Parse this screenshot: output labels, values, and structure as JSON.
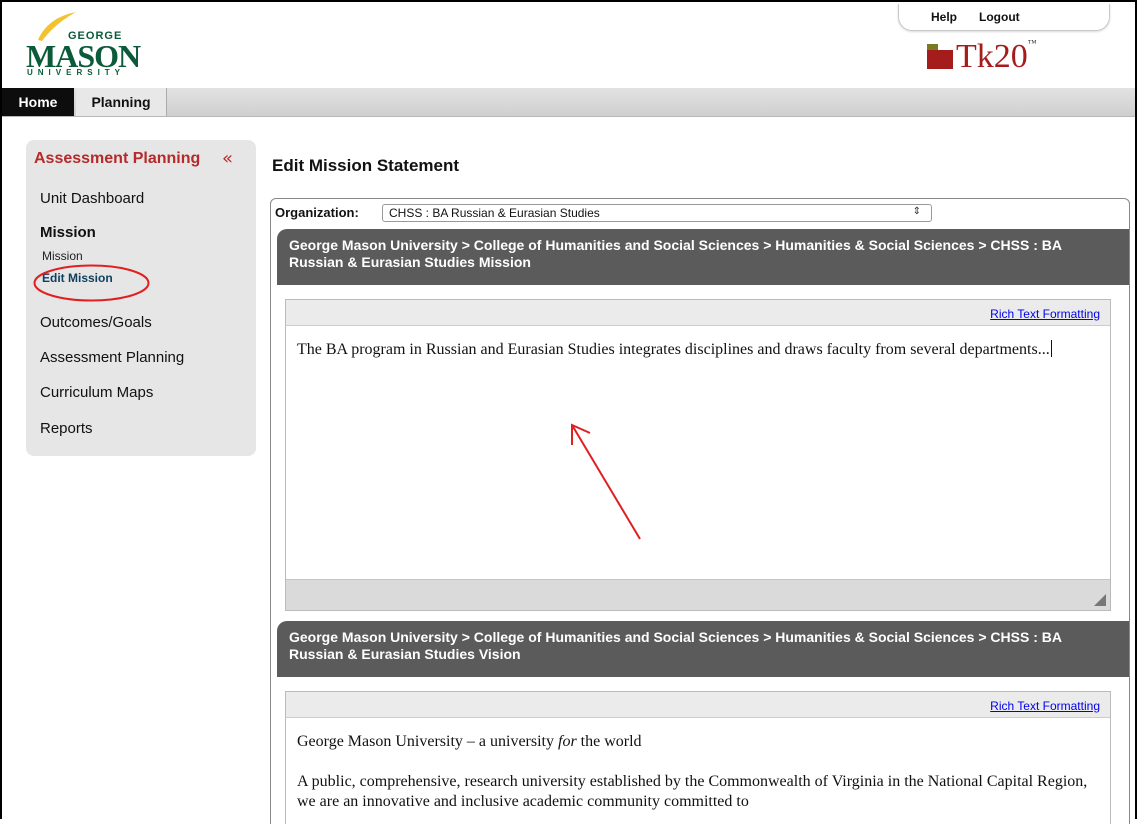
{
  "header": {
    "logo": {
      "top": "GEORGE",
      "main": "MASON",
      "bottom": "UNIVERSITY"
    },
    "help_label": "Help",
    "logout_label": "Logout",
    "product_logo": "Tk20",
    "product_tm": "™"
  },
  "nav": {
    "tabs": [
      {
        "label": "Home"
      },
      {
        "label": "Planning"
      }
    ]
  },
  "sidebar": {
    "title": "Assessment Planning",
    "collapse_glyph": "«",
    "items": [
      {
        "label": "Unit Dashboard"
      },
      {
        "label": "Mission"
      },
      {
        "label": "Mission"
      },
      {
        "label": "Edit Mission"
      },
      {
        "label": "Outcomes/Goals"
      },
      {
        "label": "Assessment Planning"
      },
      {
        "label": "Curriculum Maps"
      },
      {
        "label": "Reports"
      }
    ]
  },
  "main": {
    "title": "Edit Mission Statement",
    "organization_label": "Organization:",
    "organization_value": "CHSS : BA Russian & Eurasian Studies",
    "mission_header": "George Mason University > College of Humanities and Social Sciences > Humanities & Social Sciences > CHSS : BA Russian & Eurasian Studies Mission",
    "mission_rtf_label": "Rich Text Formatting",
    "mission_text": "The BA program in Russian and Eurasian Studies integrates disciplines and draws faculty from several departments...",
    "vision_header": "George Mason University > College of Humanities and Social Sciences > Humanities & Social Sciences > CHSS : BA Russian & Eurasian Studies Vision",
    "vision_rtf_label": "Rich Text Formatting",
    "vision_line1_a": "George Mason University – a university ",
    "vision_line1_em": "for",
    "vision_line1_b": " the world",
    "vision_para2": "A public, comprehensive, research university established by the Commonwealth of Virginia in the National Capital Region, we are an innovative and inclusive academic community committed to"
  },
  "colors": {
    "brand_green": "#0b5a3a",
    "brand_gold": "#f2c230",
    "accent_red": "#b52a2a",
    "header_gray": "#5b5b5b",
    "annotation_red": "#e02020"
  }
}
